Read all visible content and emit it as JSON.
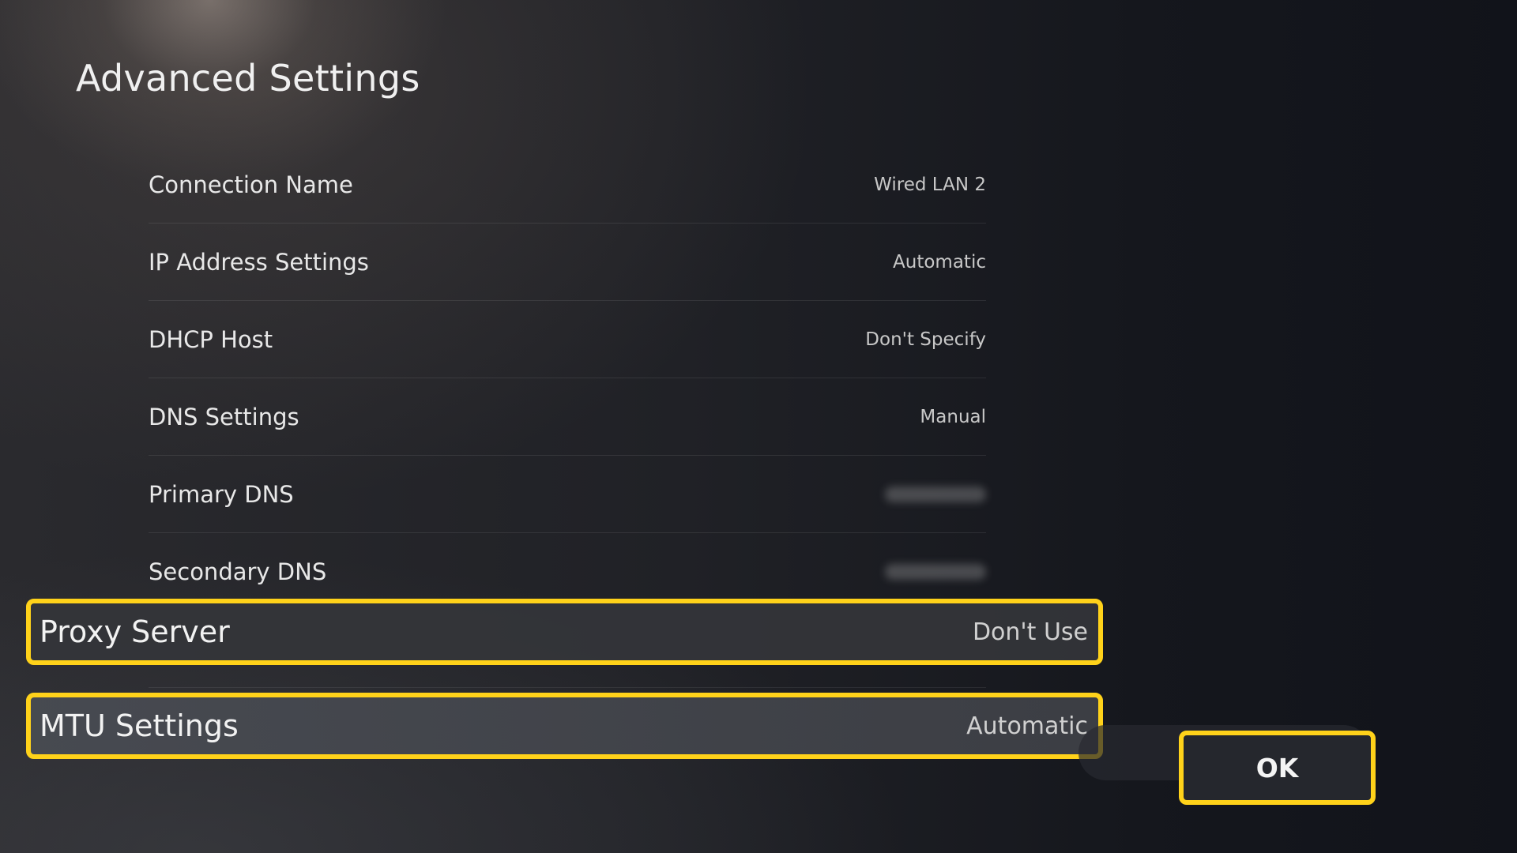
{
  "page": {
    "title": "Advanced Settings"
  },
  "settings": [
    {
      "label": "Connection Name",
      "value": "Wired LAN 2"
    },
    {
      "label": "IP Address Settings",
      "value": "Automatic"
    },
    {
      "label": "DHCP Host",
      "value": "Don't Specify"
    },
    {
      "label": "DNS Settings",
      "value": "Manual"
    },
    {
      "label": "Primary DNS",
      "value": ""
    },
    {
      "label": "Secondary DNS",
      "value": ""
    }
  ],
  "highlighted": {
    "proxy": {
      "label": "Proxy Server",
      "value": "Don't Use"
    },
    "mtu": {
      "label": "MTU Settings",
      "value": "Automatic"
    }
  },
  "ok_button": {
    "label": "OK"
  },
  "colors": {
    "focus_highlight": "#ffd21a",
    "background": "#141519"
  }
}
